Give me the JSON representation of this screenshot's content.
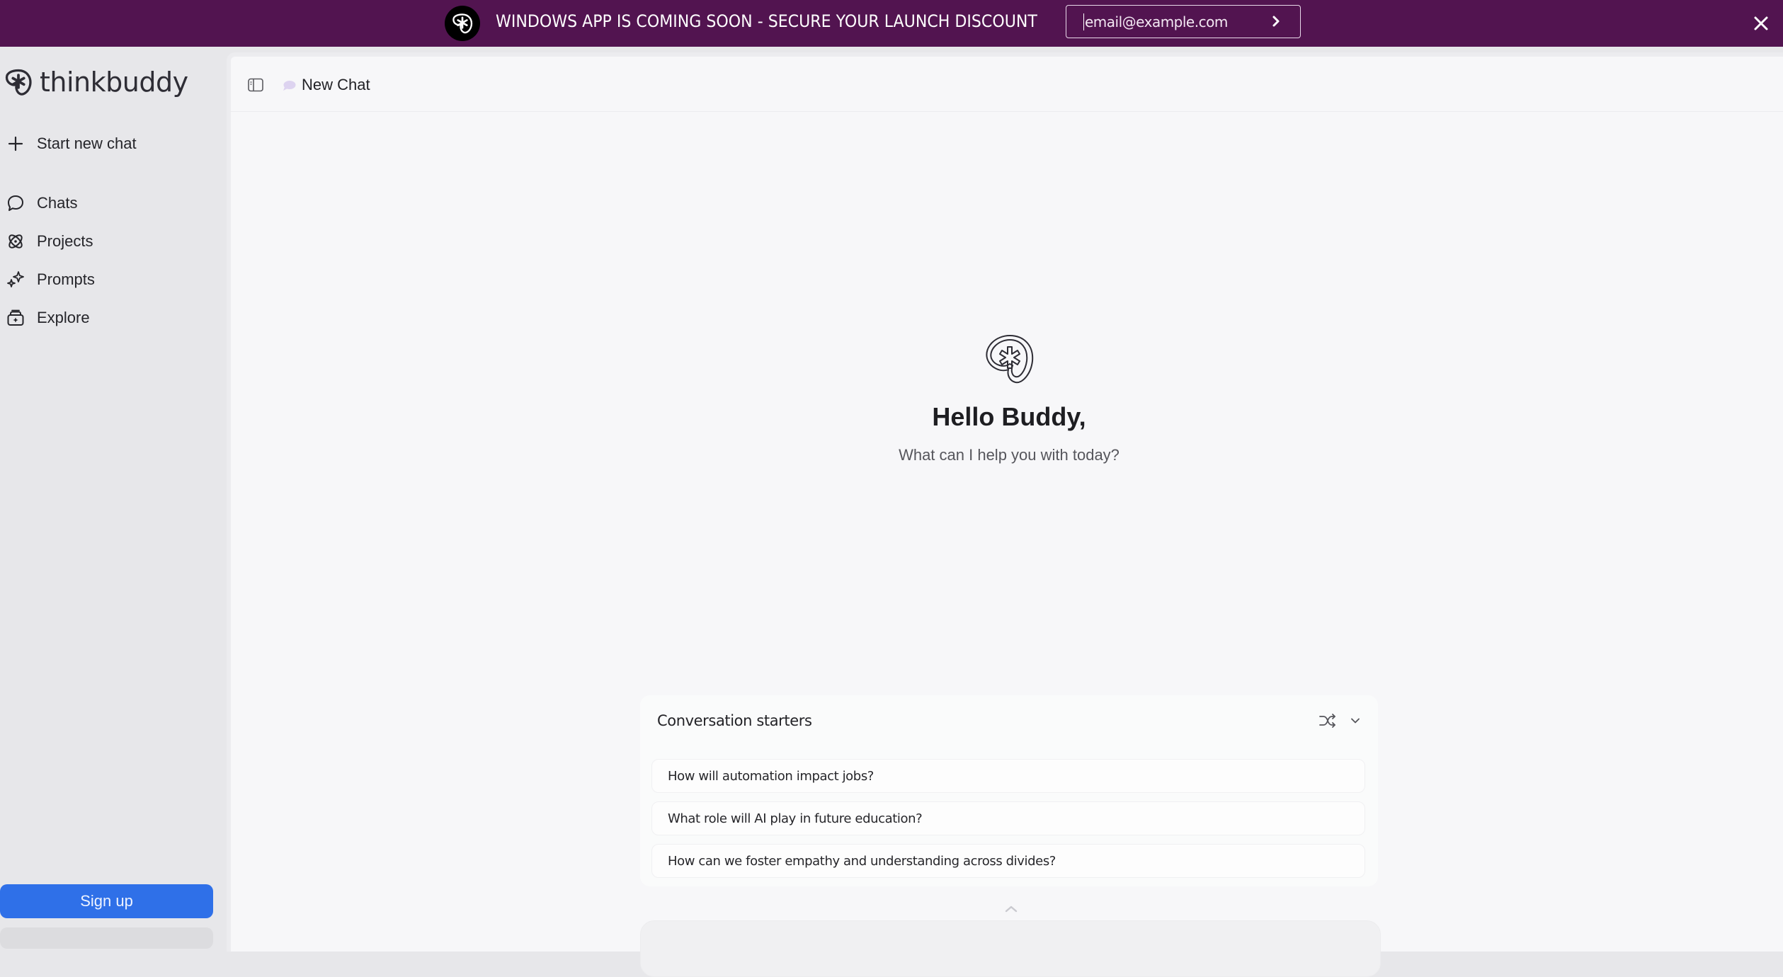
{
  "banner": {
    "message": "WINDOWS APP IS COMING SOON - SECURE YOUR LAUNCH DISCOUNT",
    "email_placeholder": "email@example.com",
    "email_value": "",
    "submit_icon": "chevron-right-icon",
    "close_icon": "close-icon",
    "background_color": "#521450"
  },
  "sidebar": {
    "brand_name": "thinkbuddy",
    "new_chat_label": "Start new chat",
    "items": [
      {
        "label": "Chats",
        "icon": "chat-bubble-icon"
      },
      {
        "label": "Projects",
        "icon": "atom-icon"
      },
      {
        "label": "Prompts",
        "icon": "sparkles-icon"
      },
      {
        "label": "Explore",
        "icon": "toolbox-icon"
      }
    ],
    "signup_label": "Sign up",
    "accent_color": "#2f70e8"
  },
  "main": {
    "chat_title": "New Chat",
    "greeting": "Hello Buddy,",
    "subtitle": "What can I help you with today?",
    "starters": {
      "title": "Conversation starters",
      "items": [
        "How will automation impact jobs?",
        "What role will AI play in future education?",
        "How can we foster empathy and understanding across divides?"
      ]
    }
  }
}
